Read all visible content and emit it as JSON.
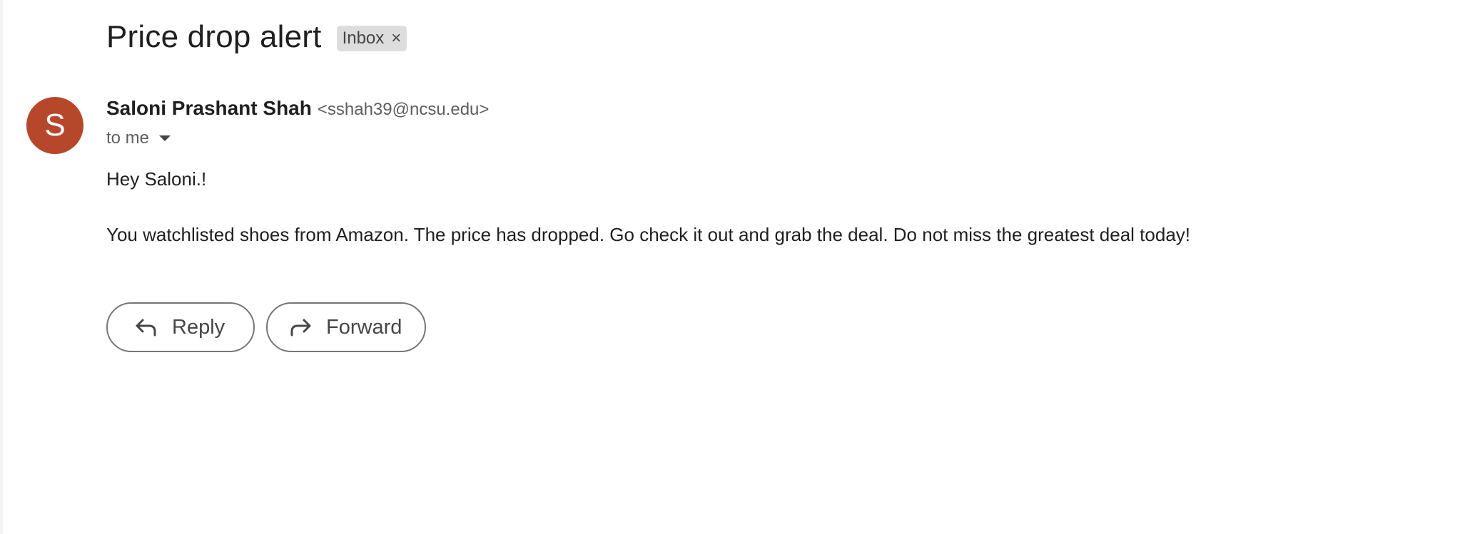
{
  "email": {
    "subject": "Price drop alert",
    "label": {
      "text": "Inbox",
      "remove_glyph": "×"
    },
    "sender": {
      "avatar_letter": "S",
      "avatar_color": "#b7472a",
      "name": "Saloni Prashant Shah",
      "email": "<sshah39@ncsu.edu>"
    },
    "recipient_text": "to me",
    "body": {
      "greeting": "Hey Saloni.!",
      "message": "You watchlisted shoes from Amazon. The price has dropped. Go check it out and grab the deal. Do not miss the greatest deal today!"
    },
    "actions": {
      "reply_label": "Reply",
      "reply_icon": "reply-arrow-icon",
      "forward_label": "Forward",
      "forward_icon": "forward-arrow-icon"
    }
  }
}
